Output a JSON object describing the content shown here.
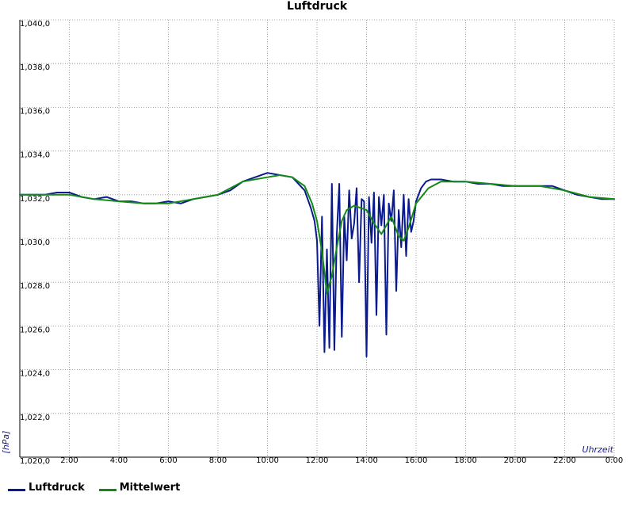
{
  "chart_data": {
    "type": "line",
    "title": "Luftdruck",
    "xlabel": "Uhrzeit",
    "ylabel": "[hPa]",
    "xlim": [
      0,
      24
    ],
    "ylim": [
      1020,
      1040
    ],
    "x_tick_labels": [
      "2:00",
      "4:00",
      "6:00",
      "8:00",
      "10:00",
      "12:00",
      "14:00",
      "16:00",
      "18:00",
      "20:00",
      "22:00",
      "0:00"
    ],
    "y_tick_labels": [
      "1,020,0",
      "1,022,0",
      "1,024,0",
      "1,026,0",
      "1,028,0",
      "1,030,0",
      "1,032,0",
      "1,034,0",
      "1,036,0",
      "1,038,0",
      "1,040,0"
    ],
    "grid": true,
    "legend_position": "bottom-left",
    "series": [
      {
        "name": "Luftdruck",
        "color": "#0a1a8c",
        "x": [
          0.0,
          0.5,
          1.0,
          1.5,
          2.0,
          2.5,
          3.0,
          3.5,
          4.0,
          4.5,
          5.0,
          5.5,
          6.0,
          6.5,
          7.0,
          7.5,
          8.0,
          8.5,
          9.0,
          9.5,
          10.0,
          10.5,
          11.0,
          11.5,
          11.75,
          11.9,
          12.0,
          12.1,
          12.2,
          12.3,
          12.4,
          12.5,
          12.6,
          12.7,
          12.8,
          12.9,
          13.0,
          13.1,
          13.2,
          13.3,
          13.4,
          13.5,
          13.6,
          13.7,
          13.8,
          13.9,
          14.0,
          14.1,
          14.2,
          14.3,
          14.4,
          14.5,
          14.6,
          14.7,
          14.8,
          14.9,
          15.0,
          15.1,
          15.2,
          15.3,
          15.4,
          15.5,
          15.6,
          15.7,
          15.8,
          15.9,
          16.0,
          16.2,
          16.4,
          16.6,
          16.8,
          17.0,
          17.5,
          18.0,
          18.5,
          19.0,
          19.5,
          20.0,
          20.5,
          21.0,
          21.5,
          22.0,
          22.5,
          23.0,
          23.5,
          24.0
        ],
        "y": [
          1032.0,
          1032.0,
          1032.0,
          1032.1,
          1032.1,
          1031.9,
          1031.8,
          1031.9,
          1031.7,
          1031.7,
          1031.6,
          1031.6,
          1031.7,
          1031.6,
          1031.8,
          1031.9,
          1032.0,
          1032.2,
          1032.6,
          1032.8,
          1033.0,
          1032.9,
          1032.8,
          1032.2,
          1031.4,
          1030.8,
          1029.9,
          1026.0,
          1031.0,
          1024.8,
          1029.5,
          1025.0,
          1032.5,
          1024.9,
          1030.2,
          1032.5,
          1025.5,
          1031.0,
          1029.0,
          1032.2,
          1030.0,
          1030.7,
          1032.3,
          1028.0,
          1031.8,
          1031.7,
          1024.6,
          1031.9,
          1029.8,
          1032.1,
          1026.5,
          1031.9,
          1030.6,
          1032.0,
          1025.6,
          1031.6,
          1030.8,
          1032.2,
          1027.6,
          1031.3,
          1029.6,
          1032.0,
          1029.2,
          1031.8,
          1030.3,
          1030.8,
          1031.7,
          1032.3,
          1032.6,
          1032.7,
          1032.7,
          1032.7,
          1032.6,
          1032.6,
          1032.5,
          1032.5,
          1032.4,
          1032.4,
          1032.4,
          1032.4,
          1032.4,
          1032.2,
          1032.0,
          1031.9,
          1031.8,
          1031.8
        ]
      },
      {
        "name": "Mittelwert",
        "color": "#138a13",
        "x": [
          0.0,
          1.0,
          2.0,
          3.0,
          4.0,
          5.0,
          6.0,
          7.0,
          8.0,
          9.0,
          10.0,
          10.5,
          11.0,
          11.5,
          11.8,
          12.0,
          12.2,
          12.4,
          12.6,
          12.8,
          13.0,
          13.2,
          13.5,
          14.0,
          14.3,
          14.6,
          14.8,
          15.0,
          15.3,
          15.5,
          15.7,
          16.0,
          16.5,
          17.0,
          18.0,
          19.0,
          20.0,
          21.0,
          22.0,
          23.0,
          24.0
        ],
        "y": [
          1032.0,
          1032.0,
          1032.0,
          1031.8,
          1031.7,
          1031.6,
          1031.6,
          1031.8,
          1032.0,
          1032.6,
          1032.8,
          1032.9,
          1032.8,
          1032.4,
          1031.6,
          1030.8,
          1029.4,
          1027.5,
          1028.3,
          1029.6,
          1030.8,
          1031.3,
          1031.5,
          1031.3,
          1030.7,
          1030.2,
          1030.6,
          1031.0,
          1030.1,
          1029.9,
          1030.5,
          1031.6,
          1032.3,
          1032.6,
          1032.6,
          1032.5,
          1032.4,
          1032.4,
          1032.2,
          1031.9,
          1031.8
        ]
      }
    ]
  },
  "legend": {
    "items": [
      {
        "label": "Luftdruck",
        "color": "#0a1a8c"
      },
      {
        "label": "Mittelwert",
        "color": "#138a13"
      }
    ]
  }
}
